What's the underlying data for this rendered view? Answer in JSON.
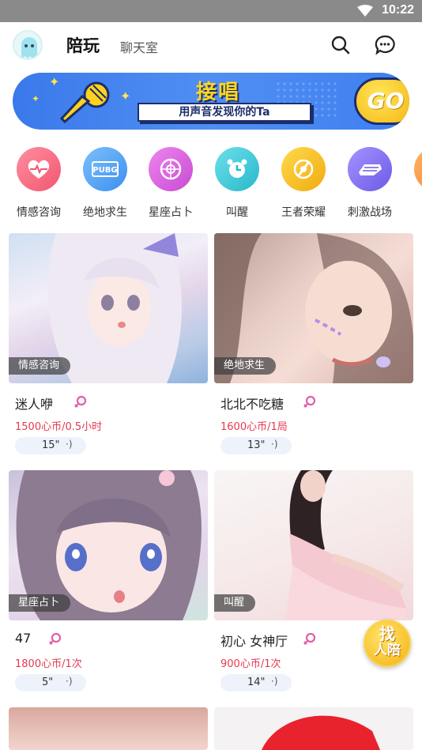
{
  "status": {
    "time": "10:22"
  },
  "header": {
    "tab_active": "陪玩",
    "tab_other": "聊天室"
  },
  "banner": {
    "title": "接唱",
    "subtitle": "用声音发现你的Ta",
    "go_label": "GO"
  },
  "categories": [
    {
      "label": "情感咨询",
      "icon": "heart-pulse-icon",
      "color": "#f3627a"
    },
    {
      "label": "绝地求生",
      "icon": "pubg-icon",
      "color": "#4b9ff2"
    },
    {
      "label": "星座占卜",
      "icon": "zodiac-icon",
      "color": "#d45ad8"
    },
    {
      "label": "叫醒",
      "icon": "alarm-clock-icon",
      "color": "#36c7d6"
    },
    {
      "label": "王者荣耀",
      "icon": "king-glory-icon",
      "color": "#f3c21b"
    },
    {
      "label": "刺激战场",
      "icon": "battlefield-icon",
      "color": "#7a6cf0"
    }
  ],
  "cards": [
    {
      "tag": "情感咨询",
      "name": "迷人咿",
      "price": "1500心币/0.5小时",
      "voice": "15\""
    },
    {
      "tag": "绝地求生",
      "name": "北北不吃糖",
      "price": "1600心币/1局",
      "voice": "13\""
    },
    {
      "tag": "星座占卜",
      "name": "47",
      "price": "1800心币/1次",
      "voice": "5\""
    },
    {
      "tag": "叫醒",
      "name": "初心   女神厅",
      "price": "900心币/1次",
      "voice": "14\""
    }
  ],
  "fab": {
    "line1": "找",
    "line2": "人陪"
  }
}
